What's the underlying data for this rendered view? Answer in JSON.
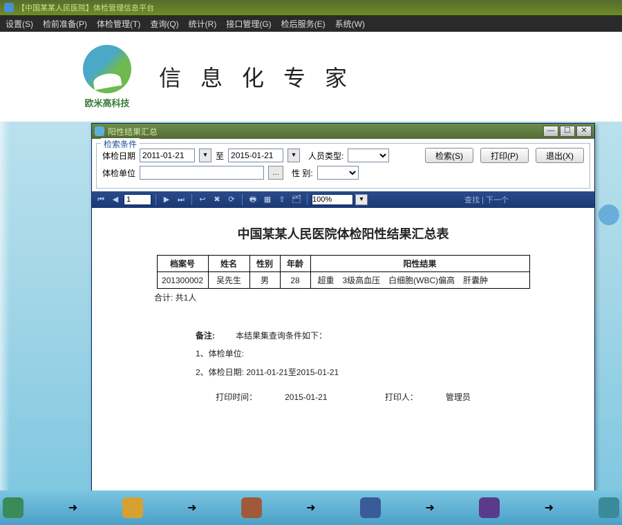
{
  "main_window": {
    "title": "【中国某某人民医院】体检管理信息平台"
  },
  "menu": {
    "items": [
      "设置(S)",
      "检前准备(P)",
      "体检管理(T)",
      "查询(Q)",
      "统计(R)",
      "接口管理(G)",
      "检后服务(E)",
      "系统(W)"
    ]
  },
  "banner": {
    "logo_caption": "欧米高科技",
    "title": "信息化专家"
  },
  "dialog": {
    "title": "阳性结果汇总",
    "criteria": {
      "legend": "检索条件",
      "date_label": "体检日期",
      "date_from": "2011-01-21",
      "date_to_label": "至",
      "date_to": "2015-01-21",
      "person_type_label": "人员类型:",
      "person_type_value": "",
      "unit_label": "体检单位",
      "unit_value": "",
      "gender_label": "性    别:",
      "gender_value": ""
    },
    "buttons": {
      "search": "检索(S)",
      "print": "打印(P)",
      "exit": "退出(X)"
    },
    "toolbar": {
      "page_num": "1",
      "zoom": "100%",
      "nav_text": "查找 | 下一个"
    },
    "report": {
      "title": "中国某某人民医院体检阳性结果汇总表",
      "headers": {
        "id": "档案号",
        "name": "姓名",
        "gender": "性别",
        "age": "年龄",
        "result": "阳性结果"
      },
      "rows": [
        {
          "id": "201300002",
          "name": "吴先生",
          "gender": "男",
          "age": "28",
          "result": "超重　3级高血压　白细胞(WBC)偏高　肝囊肿"
        }
      ],
      "total": "合计: 共1人",
      "remarks_label": "备注:",
      "remarks_intro": "本结果集查询条件如下：",
      "remark1": "1、体检单位:",
      "remark2": "2、体检日期: 2011-01-21至2015-01-21",
      "print_time_label": "打印时间：",
      "print_time": "2015-01-21",
      "printer_label": "打印人：",
      "printer": "管理员"
    }
  }
}
